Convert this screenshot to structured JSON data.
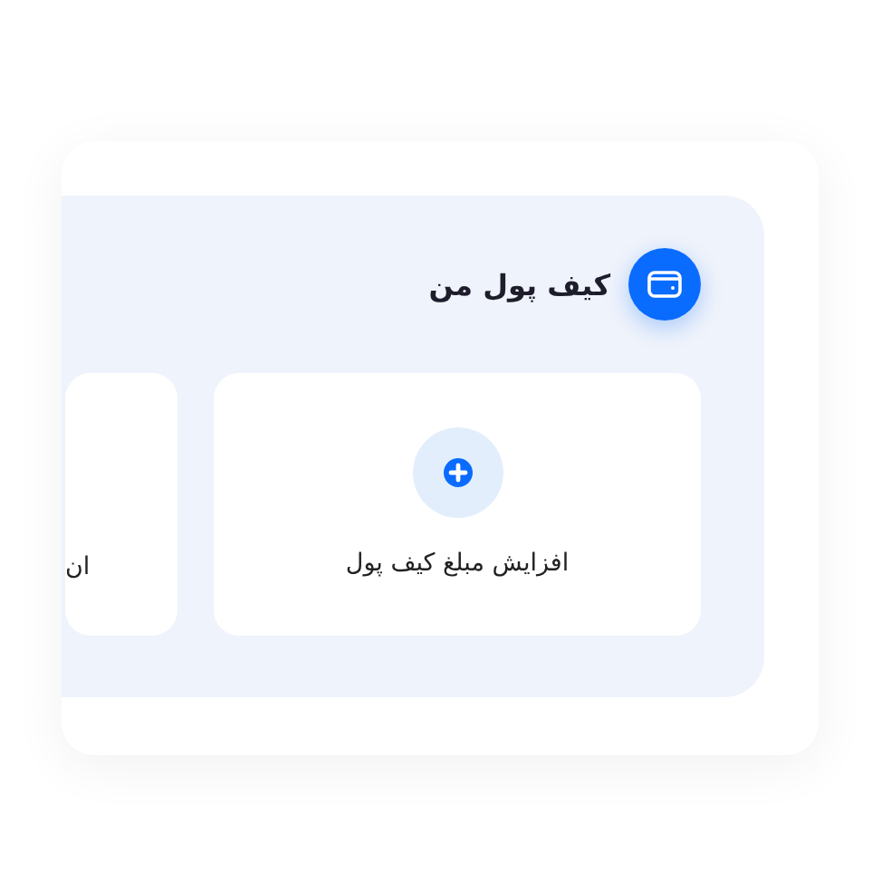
{
  "wallet": {
    "title": "کیف پول من",
    "cards": [
      {
        "kind": "action",
        "label": "افزایش مبلغ کیف پول"
      },
      {
        "kind": "text",
        "label": "ان"
      }
    ]
  }
}
